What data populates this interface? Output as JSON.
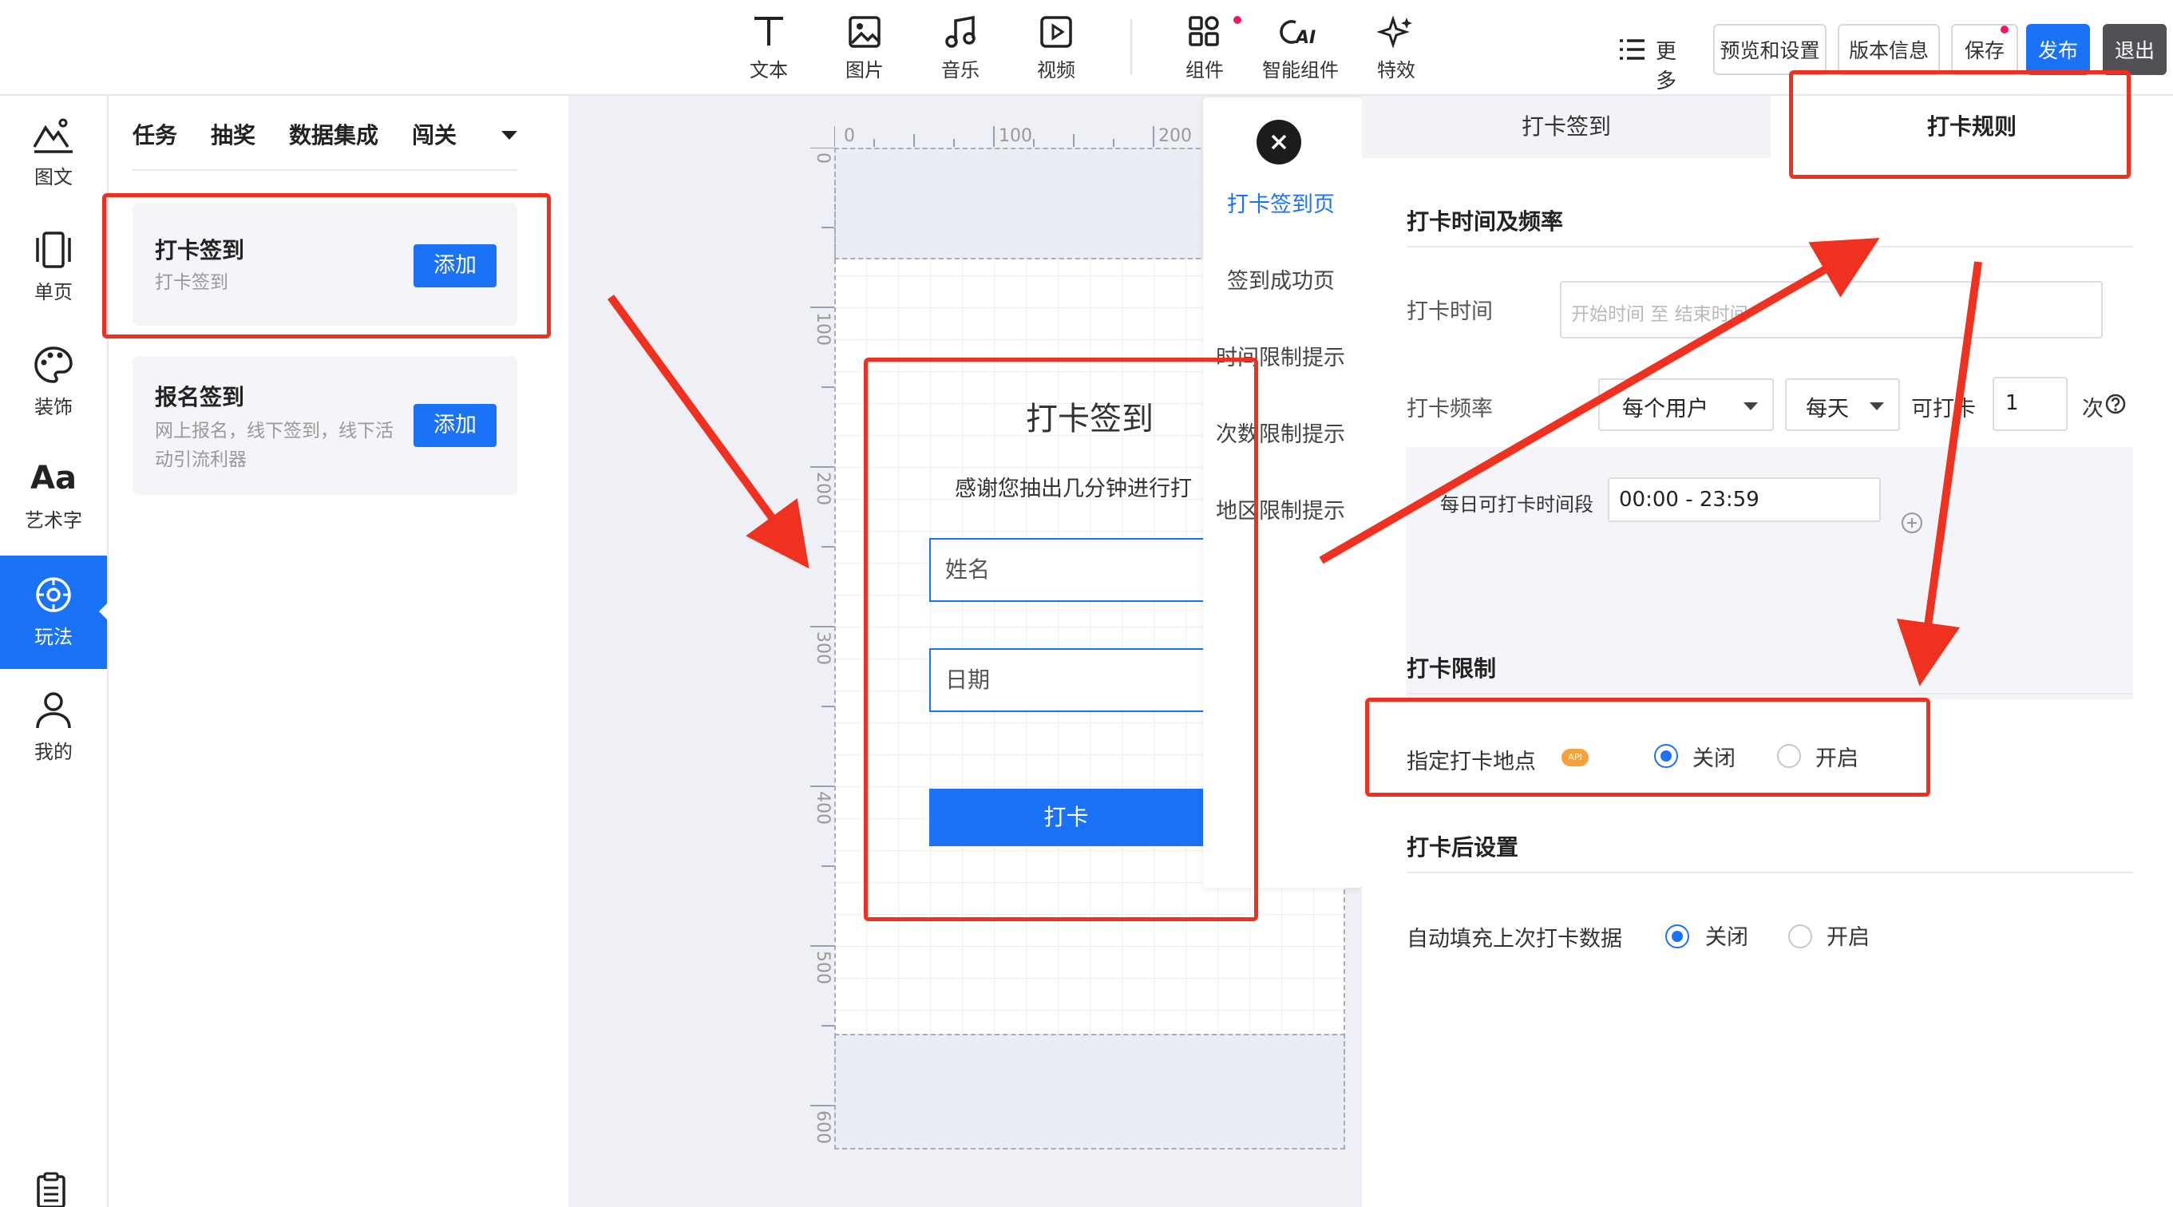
{
  "toolbar": {
    "tools": [
      {
        "label": "文本",
        "icon": "text-icon"
      },
      {
        "label": "图片",
        "icon": "image-icon"
      },
      {
        "label": "音乐",
        "icon": "music-icon"
      },
      {
        "label": "视频",
        "icon": "video-icon"
      },
      {
        "label": "组件",
        "icon": "components-icon"
      },
      {
        "label": "智能组件",
        "icon": "ai-icon"
      },
      {
        "label": "特效",
        "icon": "sparkle-icon"
      }
    ],
    "more_label": "更多",
    "preview_label": "预览和设置",
    "version_label": "版本信息",
    "save_label": "保存",
    "publish_label": "发布",
    "exit_label": "退出"
  },
  "rail": {
    "items": [
      {
        "label": "图文",
        "icon": "image-text-icon"
      },
      {
        "label": "单页",
        "icon": "single-page-icon"
      },
      {
        "label": "装饰",
        "icon": "palette-icon"
      },
      {
        "label": "艺术字",
        "icon": "art-text-icon",
        "glyph": "Aa"
      },
      {
        "label": "玩法",
        "icon": "gameplay-icon",
        "active": true
      },
      {
        "label": "我的",
        "icon": "user-icon"
      }
    ],
    "bottom_icon": "clipboard-icon"
  },
  "library": {
    "tabs": [
      "任务",
      "抽奖",
      "数据集成",
      "闯关"
    ],
    "cards": [
      {
        "title": "打卡签到",
        "desc": "打卡签到",
        "button": "添加"
      },
      {
        "title": "报名签到",
        "desc": "网上报名，线下签到，线下活动引流利器",
        "button": "添加"
      }
    ]
  },
  "canvas": {
    "ruler_h": [
      "0",
      "100",
      "200"
    ],
    "ruler_v": [
      "0",
      "100",
      "200",
      "300",
      "400",
      "500",
      "600"
    ],
    "form": {
      "title": "打卡签到",
      "subtitle": "感谢您抽出几分钟进行打",
      "name_placeholder": "姓名",
      "date_placeholder": "日期",
      "submit_label": "打卡"
    }
  },
  "pagelist": {
    "items": [
      "打卡签到页",
      "签到成功页",
      "时间限制提示",
      "次数限制提示",
      "地区限制提示"
    ],
    "active_index": 0
  },
  "panel": {
    "tabs": [
      "打卡签到",
      "打卡规则"
    ],
    "active_tab": 1,
    "section1_title": "打卡时间及频率",
    "time_label": "打卡时间",
    "time_placeholder": "开始时间 至 结束时间",
    "freq_label": "打卡频率",
    "freq_user": "每个用户",
    "freq_period": "每天",
    "can_label": "可打卡",
    "count_value": "1",
    "times_unit": "次",
    "daily_label": "每日可打卡时间段",
    "daily_value": "00:00 - 23:59",
    "section2_title": "打卡限制",
    "location_label": "指定打卡地点",
    "api_badge": "API",
    "off_label": "关闭",
    "on_label": "开启",
    "location_on": false,
    "section3_title": "打卡后设置",
    "autofill_label": "自动填充上次打卡数据",
    "autofill_on": false
  },
  "colors": {
    "accent": "#1a72f6",
    "annotation": "#f0311f",
    "canvas_bg": "#eef0f6"
  }
}
